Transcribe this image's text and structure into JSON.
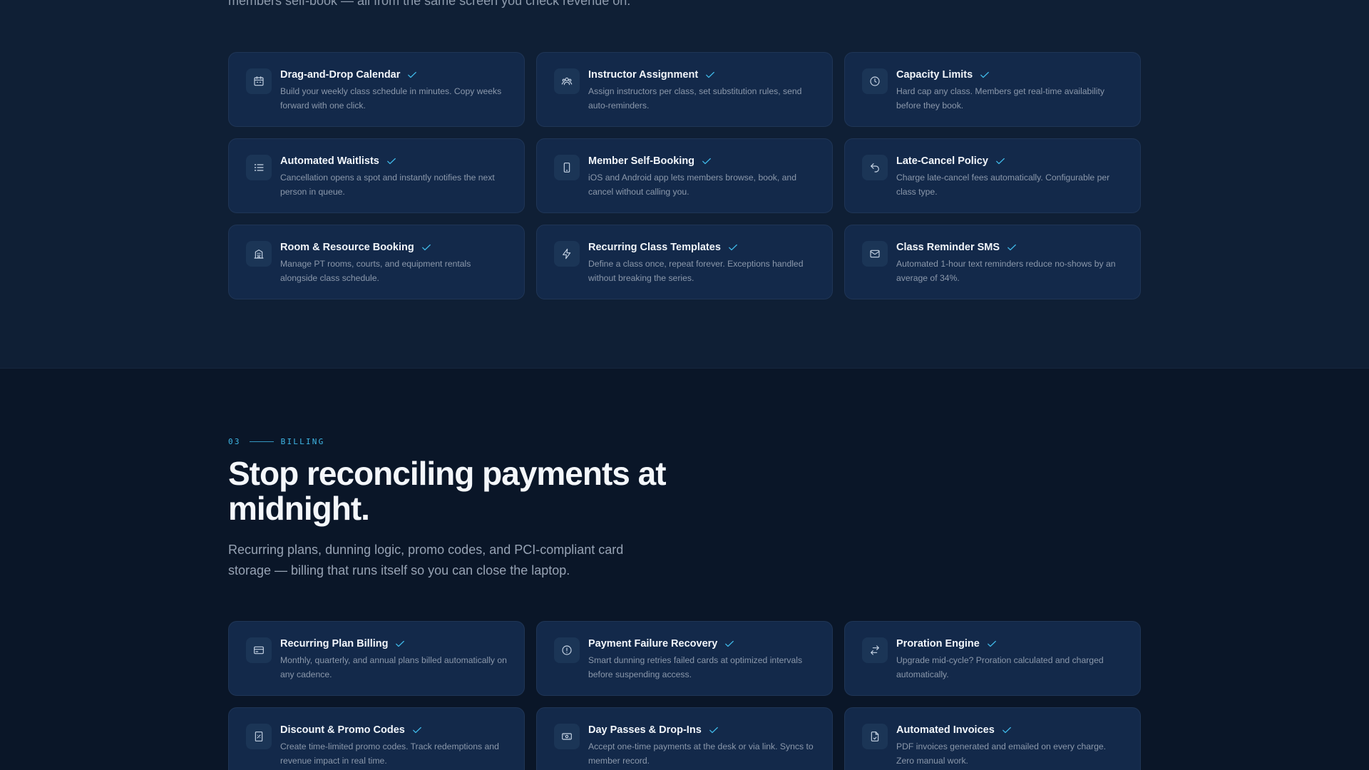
{
  "intro_tail": "members self-book — all from the same screen you check revenue on.",
  "scheduling_features": [
    {
      "icon": "calendar-icon",
      "title": "Drag-and-Drop Calendar",
      "desc": "Build your weekly class schedule in minutes. Copy weeks forward with one click."
    },
    {
      "icon": "users-icon",
      "title": "Instructor Assignment",
      "desc": "Assign instructors per class, set substitution rules, send auto-reminders."
    },
    {
      "icon": "clock-icon",
      "title": "Capacity Limits",
      "desc": "Hard cap any class. Members get real-time availability before they book."
    },
    {
      "icon": "list-icon",
      "title": "Automated Waitlists",
      "desc": "Cancellation opens a spot and instantly notifies the next person in queue."
    },
    {
      "icon": "smartphone-icon",
      "title": "Member Self-Booking",
      "desc": "iOS and Android app lets members browse, book, and cancel without calling you."
    },
    {
      "icon": "undo-icon",
      "title": "Late-Cancel Policy",
      "desc": "Charge late-cancel fees automatically. Configurable per class type."
    },
    {
      "icon": "building-icon",
      "title": "Room & Resource Booking",
      "desc": "Manage PT rooms, courts, and equipment rentals alongside class schedule."
    },
    {
      "icon": "lightning-icon",
      "title": "Recurring Class Templates",
      "desc": "Define a class once, repeat forever. Exceptions handled without breaking the series."
    },
    {
      "icon": "mail-icon",
      "title": "Class Reminder SMS",
      "desc": "Automated 1-hour text reminders reduce no-shows by an average of 34%."
    }
  ],
  "billing_section": {
    "eyebrow_number": "03",
    "eyebrow_label": "BILLING",
    "headline": "Stop reconciling payments at midnight.",
    "subtext": "Recurring plans, dunning logic, promo codes, and PCI-compliant card storage — billing that runs itself so you can close the laptop."
  },
  "billing_features": [
    {
      "icon": "credit-card-icon",
      "title": "Recurring Plan Billing",
      "desc": "Monthly, quarterly, and annual plans billed automatically on any cadence."
    },
    {
      "icon": "alert-circle-icon",
      "title": "Payment Failure Recovery",
      "desc": "Smart dunning retries failed cards at optimized intervals before suspending access."
    },
    {
      "icon": "swap-icon",
      "title": "Proration Engine",
      "desc": "Upgrade mid-cycle? Proration calculated and charged automatically."
    },
    {
      "icon": "tag-icon",
      "title": "Discount & Promo Codes",
      "desc": "Create time-limited promo codes. Track redemptions and revenue impact in real time."
    },
    {
      "icon": "ticket-icon",
      "title": "Day Passes & Drop-Ins",
      "desc": "Accept one-time payments at the desk or via link. Syncs to member record."
    },
    {
      "icon": "file-invoice-icon",
      "title": "Automated Invoices",
      "desc": "PDF invoices generated and emailed on every charge. Zero manual work."
    }
  ],
  "colors": {
    "accent": "#3fb7e6",
    "card_bg": "#13294a",
    "page_bg_top": "#0f1f35",
    "page_bg_bottom": "#0a1628"
  }
}
